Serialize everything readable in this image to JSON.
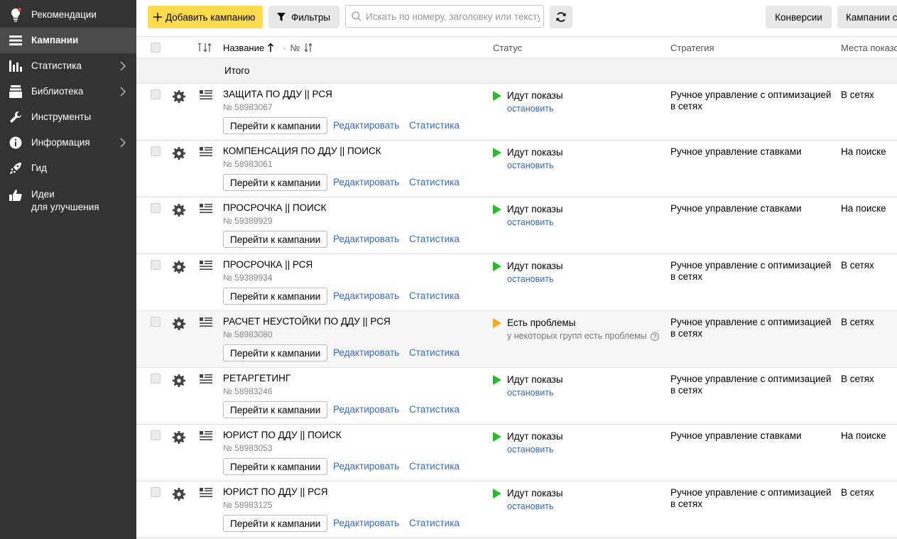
{
  "sidebar": {
    "items": [
      {
        "label": "Рекомендации",
        "icon": "bulb-icon"
      },
      {
        "label": "Кампании",
        "icon": "list-icon",
        "active": true
      },
      {
        "label": "Статистика",
        "icon": "bar-chart-icon"
      },
      {
        "label": "Библиотека",
        "icon": "library-icon"
      },
      {
        "label": "Инструменты",
        "icon": "wrench-icon"
      },
      {
        "label": "Информация",
        "icon": "info-icon"
      },
      {
        "label": "Гид",
        "icon": "rocket-icon"
      },
      {
        "label_line1": "Идеи",
        "label_line2": "для улучшения",
        "icon": "thumbs-up-icon"
      }
    ]
  },
  "toolbar": {
    "add_campaign": "Добавить кампанию",
    "filters": "Фильтры",
    "search_placeholder": "Искать по номеру, заголовку или тексту",
    "conversions": "Конверсии",
    "campaigns_cut": "Кампании с"
  },
  "table": {
    "headers": {
      "name": "Название",
      "number": "№",
      "status": "Статус",
      "strategy": "Стратегия",
      "places": "Места показо"
    },
    "total_label": "Итого",
    "actions": {
      "goto": "Перейти к кампании",
      "edit": "Редактировать",
      "stats": "Статистика"
    },
    "rows": [
      {
        "name": "ЗАЩИТА ПО ДДУ || РСЯ",
        "number": "№ 58983067",
        "status": "Идут показы",
        "status_sub": "остановить",
        "strategy": "Ручное управление с оптимизацией в сетях",
        "places": "В сетях"
      },
      {
        "name": "КОМПЕНСАЦИЯ ПО ДДУ || ПОИСК",
        "number": "№ 58983061",
        "status": "Идут показы",
        "status_sub": "остановить",
        "strategy": "Ручное управление ставками",
        "places": "На поиске"
      },
      {
        "name": "ПРОСРОЧКА || ПОИСК",
        "number": "№ 59389929",
        "status": "Идут показы",
        "status_sub": "остановить",
        "strategy": "Ручное управление ставками",
        "places": "На поиске"
      },
      {
        "name": "ПРОСРОЧКА || РСЯ",
        "number": "№ 59389934",
        "status": "Идут показы",
        "status_sub": "остановить",
        "strategy": "Ручное управление с оптимизацией в сетях",
        "places": "В сетях"
      },
      {
        "name": "РАСЧЕТ НЕУСТОЙКИ ПО ДДУ || РСЯ",
        "number": "№ 58983080",
        "status": "Есть проблемы",
        "status_sub": "у некоторых групп есть проблемы",
        "problem": true,
        "strategy": "Ручное управление с оптимизацией в сетях",
        "places": "В сетях"
      },
      {
        "name": "РЕТАРГЕТИНГ",
        "number": "№ 58983246",
        "status": "Идут показы",
        "status_sub": "остановить",
        "strategy": "Ручное управление с оптимизацией в сетях",
        "places": "В сетях"
      },
      {
        "name": "ЮРИСТ ПО ДДУ || ПОИСК",
        "number": "№ 58983053",
        "status": "Идут показы",
        "status_sub": "остановить",
        "strategy": "Ручное управление ставками",
        "places": "На поиске"
      },
      {
        "name": "ЮРИСТ ПО ДДУ || РСЯ",
        "number": "№ 58983125",
        "status": "Идут показы",
        "status_sub": "остановить",
        "strategy": "Ручное управление с оптимизацией в сетях",
        "places": "В сетях"
      }
    ]
  },
  "colors": {
    "sidebar_bg": "#333333",
    "accent_yellow": "#ffdb4d",
    "link_blue": "#3b6ab7",
    "status_ok": "#2db82d",
    "status_warn": "#f5a623"
  }
}
